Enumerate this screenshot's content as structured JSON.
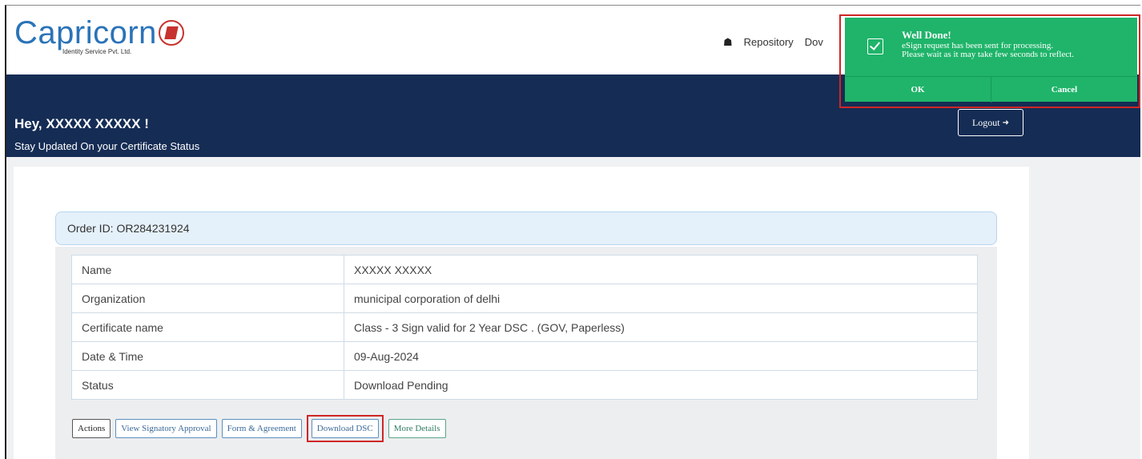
{
  "brand": {
    "name": "Capricorn",
    "tagline": "Identity Service Pvt. Ltd."
  },
  "nav": {
    "items": [
      "Repository",
      "Dov"
    ]
  },
  "header": {
    "greeting": "Hey, XXXXX XXXXX !",
    "subtitle": "Stay Updated On your Certificate Status",
    "logout_label": "Logout"
  },
  "order": {
    "label": "Order ID: OR284231924"
  },
  "details": [
    {
      "key": "Name",
      "value": "XXXXX XXXXX"
    },
    {
      "key": "Organization",
      "value": "municipal corporation of delhi"
    },
    {
      "key": "Certificate name",
      "value": "Class - 3 Sign valid for 2 Year DSC . (GOV, Paperless)"
    },
    {
      "key": "Date & Time",
      "value": "09-Aug-2024"
    },
    {
      "key": "Status",
      "value": "Download Pending"
    }
  ],
  "actions": {
    "actions_label": "Actions",
    "view_signatory": "View Signatory Approval",
    "form_agreement": "Form & Agreement",
    "download_dsc": "Download DSC",
    "more_details": "More Details"
  },
  "toast": {
    "title": "Well Done!",
    "line1": "eSign request has been sent for processing.",
    "line2": "Please wait as it may take few seconds to reflect.",
    "ok_label": "OK",
    "cancel_label": "Cancel"
  },
  "colors": {
    "banner": "#152c54",
    "toast": "#1fb46a",
    "highlight": "#d02626",
    "status_pending": "#c43c3c"
  }
}
